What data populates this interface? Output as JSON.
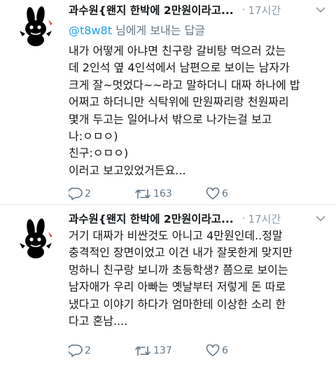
{
  "tweets": [
    {
      "author_name": "과수원{왠지 한박에 2만원이라고...",
      "dot": "·",
      "time": "17시간",
      "reply_prefix": "@t8w8t",
      "reply_suffix": " 님에게 보내는 답글",
      "lines": [
        "내가 어떻게 아냐면 친구랑 갈비탕 먹으러 갔는",
        "데 2인석 옆 4인석에서 남편으로 보이는 남자가",
        "크게 잘~멋었다~~라고 말하더니 대짜 하나에 밥",
        "어쩌고 하더니만 식탁위에 만원짜리랑 천원짜리",
        "몇개 두고는 일어나서 밖으로 나가는걸 보고",
        "나:ㅇㅁㅇ)",
        "친구:ㅇㅁㅇ)",
        "이러고 보고있었거든요..."
      ],
      "replies": "2",
      "retweets": "163",
      "likes": "6"
    },
    {
      "author_name": "과수원{왠지 한박에 2만원이라고...",
      "dot": "·",
      "time": "17시간",
      "lines": [
        "거기 대짜가 비싼것도 아니고 4만원인데..정말",
        "충격적인 장면이었고 이건 내가 잘못한게 맞지만",
        "멍하니 친구랑 보니까 초등학생? 쯤으로 보이는",
        "남자애가 우리 아빠는 옛날부터 저렇게 돈 따로",
        "냈다고 이야기 하다가 엄마한테 이상한 소리 한",
        "다고 혼남...."
      ],
      "replies": "2",
      "retweets": "137",
      "likes": "6"
    }
  ],
  "colors": {
    "text": "#14171a",
    "secondary": "#657786",
    "link": "#1da1f2",
    "divider": "#e6ecf0"
  },
  "icons": {
    "avatar": "black-rabbit-avatar",
    "menu": "chevron-down-icon",
    "reply": "reply-icon",
    "retweet": "retweet-icon",
    "like": "heart-icon"
  }
}
